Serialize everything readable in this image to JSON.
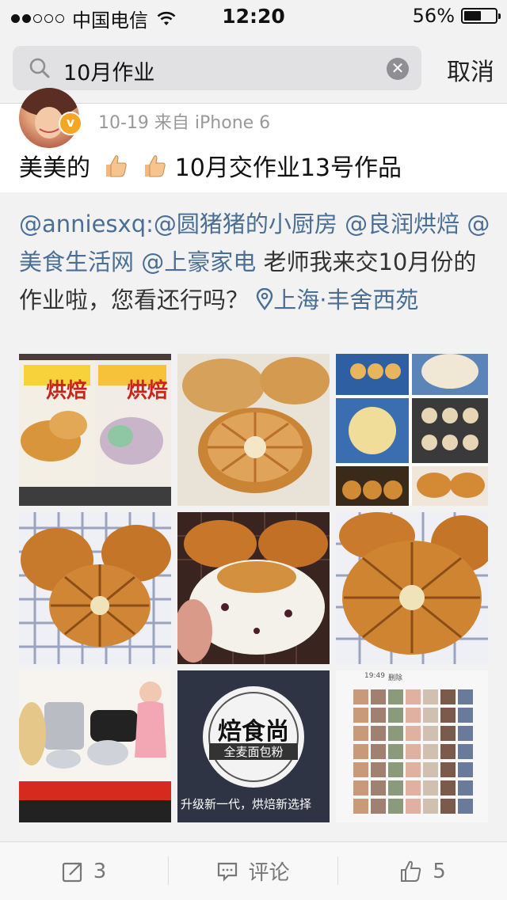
{
  "status_bar": {
    "carrier": "中国电信",
    "time": "12:20",
    "battery_percent": "56%",
    "battery_level": 0.56,
    "signal_bars": 2
  },
  "search": {
    "query": "10月作业",
    "cancel_label": "取消"
  },
  "post": {
    "meta": "10-19  来自 iPhone 6",
    "text_prefix": "美美的",
    "text_suffix": "10月交作业13号作品"
  },
  "repost": {
    "author": "@anniesxq:",
    "mention1": "@圆猪猪的小厨房",
    "mention2": "@良润烘焙",
    "mention3": "@美食生活网",
    "mention4": "@上豪家电",
    "body": " 老师我来交10月份的作业啦，您看还行吗？ ",
    "location": "上海·丰舍西苑"
  },
  "photos": {
    "p1": {
      "label1": "烘焙",
      "label2": "烘焙"
    },
    "p8": {
      "brand": "焙食尚",
      "sub": "全麦面包粉",
      "caption": "升级新一代，烘焙新选择"
    },
    "p9": {
      "time": "19:49",
      "action": "删除"
    }
  },
  "actions": {
    "repost_count": "3",
    "comment_label": "评论",
    "like_count": "5"
  },
  "colors": {
    "link": "#4a6e94",
    "badge": "#f5a623"
  }
}
